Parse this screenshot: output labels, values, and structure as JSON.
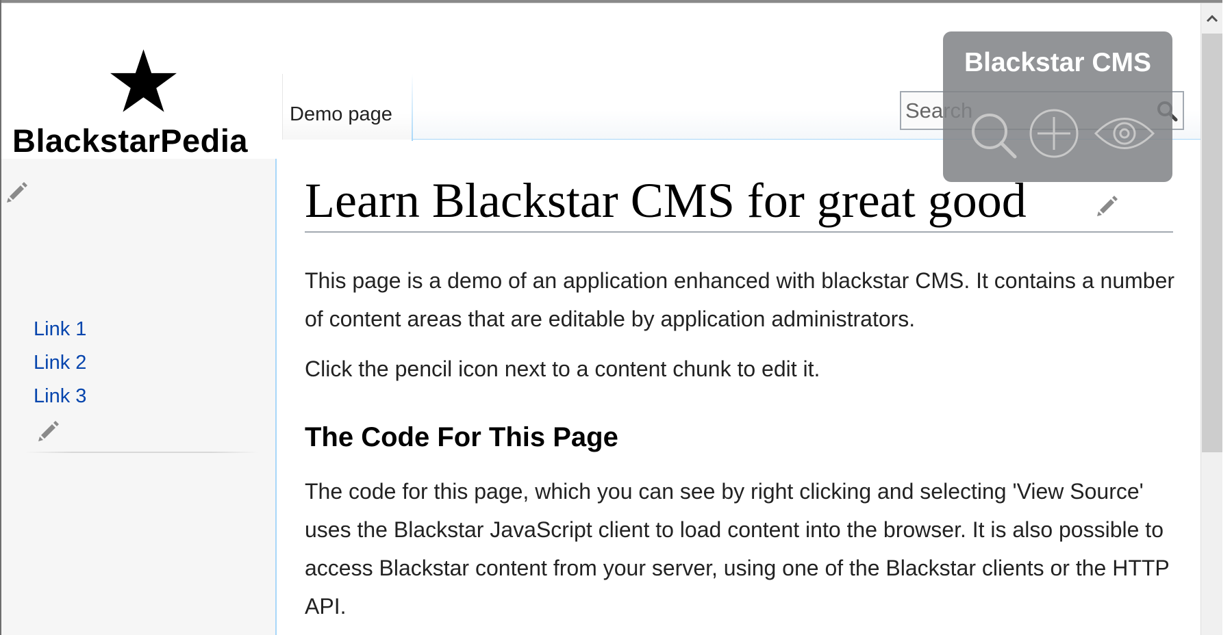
{
  "site": {
    "logo_text": "BlackstarPedia",
    "tab_label": "Demo page"
  },
  "search": {
    "placeholder": "Search"
  },
  "sidebar": {
    "links": [
      {
        "label": "Link 1"
      },
      {
        "label": "Link 2"
      },
      {
        "label": "Link 3"
      }
    ]
  },
  "content": {
    "title": "Learn Blackstar CMS for great good",
    "intro_paragraph": "This page is a demo of an application enhanced with blackstar CMS. It contains a number of content areas that are editable by application administrators.",
    "edit_hint": "Click the pencil icon next to a content chunk to edit it.",
    "section_heading": "The Code For This Page",
    "code_paragraph": "The code for this page, which you can see by right clicking and selecting 'View Source' uses the Blackstar JavaScript client to load content into the browser. It is also possible to access Blackstar content from your server, using one of the Blackstar clients or the HTTP API."
  },
  "cms_panel": {
    "title": "Blackstar CMS",
    "icons": [
      "search-icon",
      "add-icon",
      "eye-icon"
    ]
  },
  "colors": {
    "link": "#0645ad",
    "panel_overlay": "#808286",
    "sidebar_border": "#a7d7f9"
  }
}
